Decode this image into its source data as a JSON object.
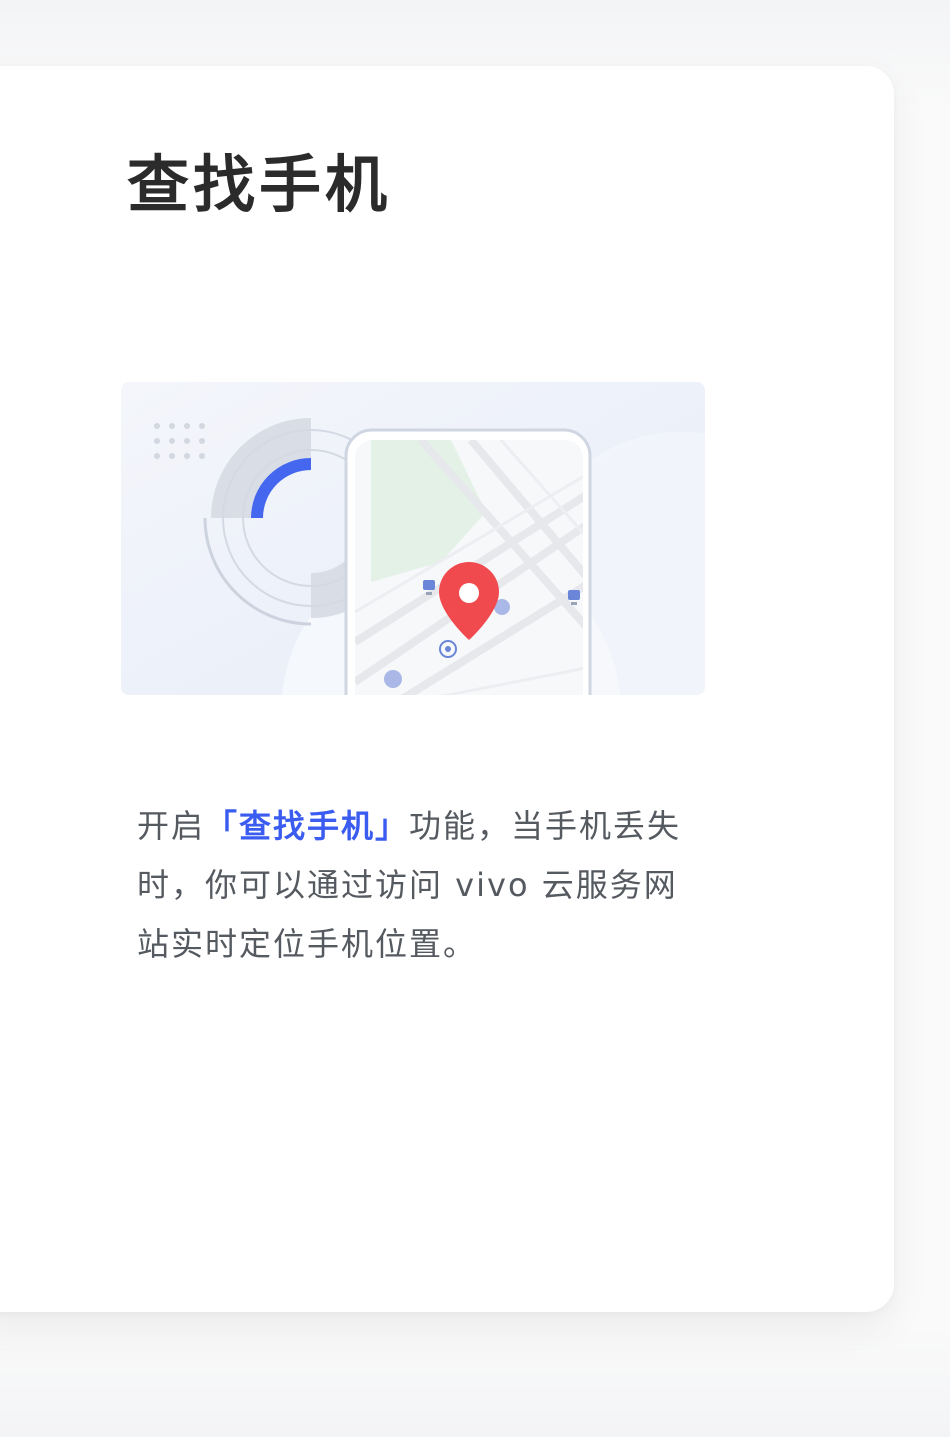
{
  "card": {
    "title": "查找手机",
    "description": {
      "prefix": "开启",
      "highlight": "「查找手机」",
      "suffix": "功能，当手机丢失时，你可以通过访问 vivo 云服务网站实时定位手机位置。"
    }
  },
  "colors": {
    "accent": "#3b5cf0",
    "pin": "#f04a4f",
    "title": "#2b2b2b",
    "body_text": "#555a60"
  },
  "icons": [
    "location-pin-icon",
    "bus-stop-icon",
    "restaurant-icon",
    "gas-station-icon",
    "radar-icon",
    "phone-icon"
  ]
}
